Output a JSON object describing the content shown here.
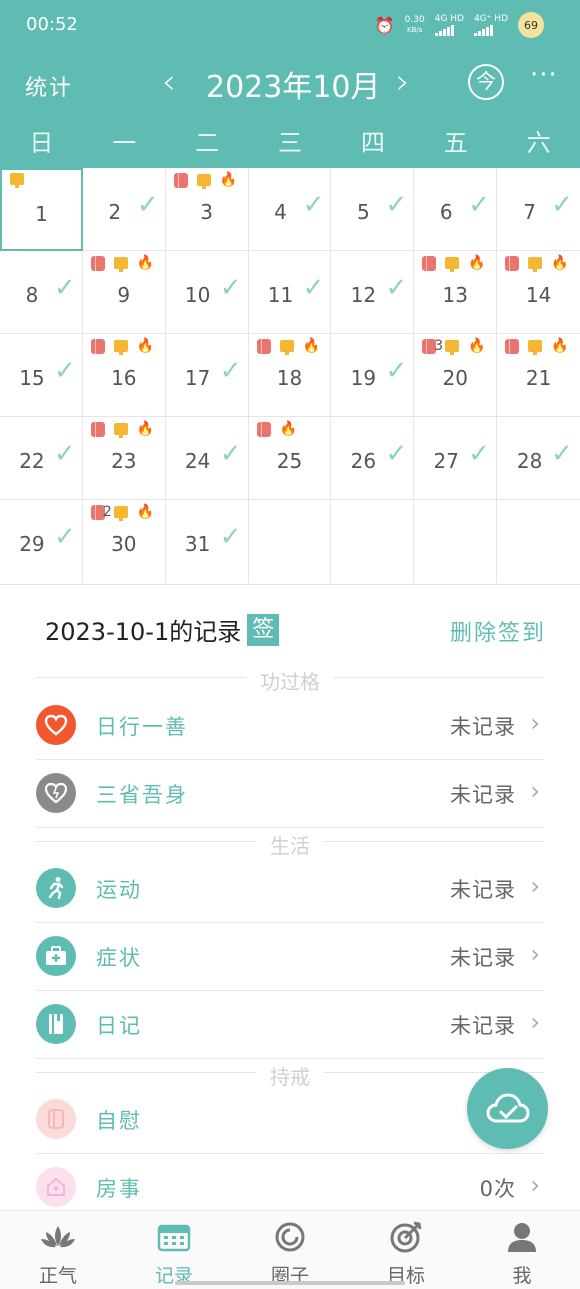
{
  "status_bar": {
    "time": "00:52",
    "net_speed_value": "0.30",
    "net_speed_unit": "KB/s",
    "sim1": "4G HD",
    "sim2": "4G⁺ HD",
    "battery": "69"
  },
  "header": {
    "stats_label": "统计",
    "prev_label": "‹",
    "title": "2023年10月",
    "next_label": "›",
    "today_label": "今",
    "more_label": "···"
  },
  "weekdays": [
    "日",
    "一",
    "二",
    "三",
    "四",
    "五",
    "六"
  ],
  "calendar": {
    "rows": [
      [
        {
          "n": "1",
          "c": false,
          "pc": true,
          "sel": true
        },
        {
          "n": "2",
          "c": true
        },
        {
          "n": "3",
          "c": false,
          "tp": true,
          "pc": true,
          "fire": true
        },
        {
          "n": "4",
          "c": true
        },
        {
          "n": "5",
          "c": true
        },
        {
          "n": "6",
          "c": true
        },
        {
          "n": "7",
          "c": true
        }
      ],
      [
        {
          "n": "8",
          "c": true
        },
        {
          "n": "9",
          "c": false,
          "tp": true,
          "pc": true,
          "fire": true
        },
        {
          "n": "10",
          "c": true
        },
        {
          "n": "11",
          "c": true
        },
        {
          "n": "12",
          "c": true
        },
        {
          "n": "13",
          "c": false,
          "tp": true,
          "pc": true,
          "fire": true
        },
        {
          "n": "14",
          "c": false,
          "tp": true,
          "pc": true,
          "fire": true
        }
      ],
      [
        {
          "n": "15",
          "c": true
        },
        {
          "n": "16",
          "c": false,
          "tp": true,
          "pc": true,
          "fire": true
        },
        {
          "n": "17",
          "c": true
        },
        {
          "n": "18",
          "c": false,
          "tp": true,
          "pc": true,
          "fire": true
        },
        {
          "n": "19",
          "c": true
        },
        {
          "n": "20",
          "c": false,
          "tp": true,
          "pc": true,
          "fire": true,
          "count": "3"
        },
        {
          "n": "21",
          "c": false,
          "tp": true,
          "pc": true,
          "fire": true
        }
      ],
      [
        {
          "n": "22",
          "c": true
        },
        {
          "n": "23",
          "c": false,
          "tp": true,
          "pc": true,
          "fire": true
        },
        {
          "n": "24",
          "c": true
        },
        {
          "n": "25",
          "c": false,
          "tp": true,
          "fire": true
        },
        {
          "n": "26",
          "c": true
        },
        {
          "n": "27",
          "c": true
        },
        {
          "n": "28",
          "c": true
        }
      ],
      [
        {
          "n": "29",
          "c": true
        },
        {
          "n": "30",
          "c": false,
          "tp": true,
          "pc": true,
          "fire": true,
          "count": "2"
        },
        {
          "n": "31",
          "c": true
        },
        {
          "n": ""
        },
        {
          "n": ""
        },
        {
          "n": ""
        },
        {
          "n": ""
        }
      ]
    ]
  },
  "record": {
    "title": "2023-10-1的记录",
    "badge": "签",
    "delete_label": "删除签到",
    "section_merit": "功过格",
    "section_life": "生活",
    "section_precept": "持戒",
    "items": {
      "good_deed": {
        "label": "日行一善",
        "value": "未记录",
        "icon": "heart-icon"
      },
      "reflect": {
        "label": "三省吾身",
        "value": "未记录",
        "icon": "heart-reflect-icon"
      },
      "exercise": {
        "label": "运动",
        "value": "未记录",
        "icon": "running-icon"
      },
      "symptom": {
        "label": "症状",
        "value": "未记录",
        "icon": "medkit-icon"
      },
      "diary": {
        "label": "日记",
        "value": "未记录",
        "icon": "notebook-icon"
      },
      "selfrelief": {
        "label": "自慰",
        "value": "",
        "icon": "tissue-icon"
      },
      "intimacy": {
        "label": "房事",
        "value": "0次",
        "icon": "house-icon"
      }
    }
  },
  "bottom_nav": [
    {
      "label": "正气",
      "icon": "lotus-icon"
    },
    {
      "label": "记录",
      "icon": "calendar-icon"
    },
    {
      "label": "圈子",
      "icon": "circle-icon"
    },
    {
      "label": "目标",
      "icon": "target-icon"
    },
    {
      "label": "我",
      "icon": "person-icon"
    }
  ],
  "colors": {
    "accent": "#5fbcb3",
    "check": "#8dd1c9",
    "heart": "#f1582f",
    "tissue": "#e9756d",
    "pc": "#f5b731",
    "fire": "#ee5744"
  }
}
